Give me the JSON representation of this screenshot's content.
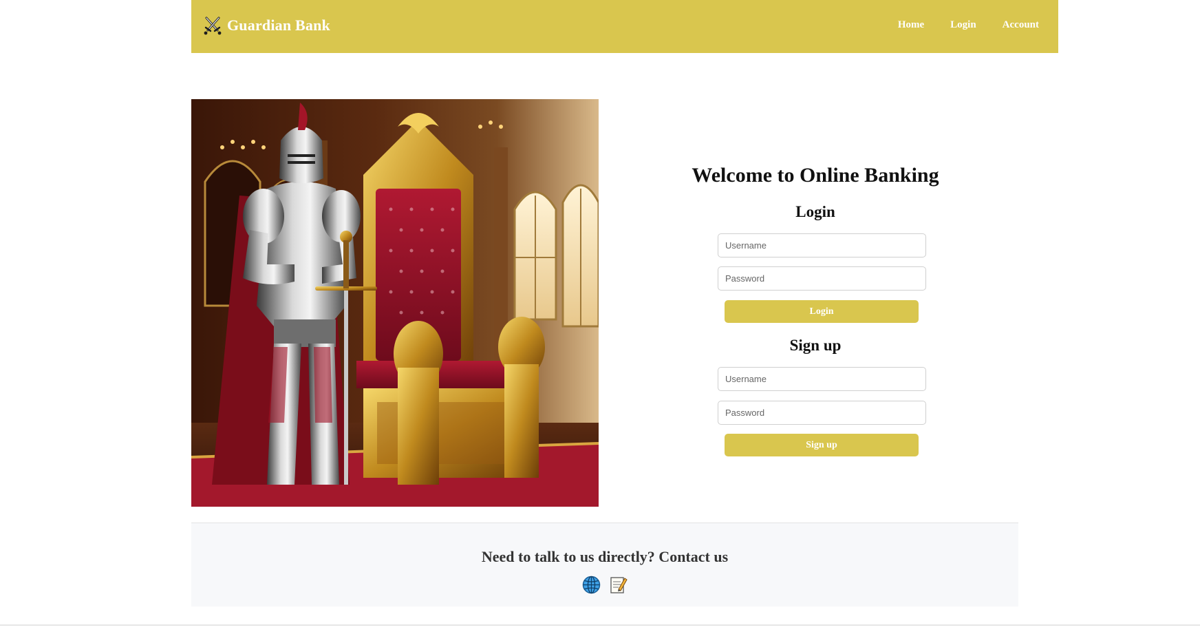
{
  "theme": {
    "brand": "#D9C64E"
  },
  "header": {
    "brand_icon": "crossed-swords-icon",
    "brand_name": "Guardian Bank",
    "nav": [
      {
        "label": "Home"
      },
      {
        "label": "Login"
      },
      {
        "label": "Account"
      }
    ]
  },
  "hero": {
    "image_subject": "knight in armor beside red-and-gold throne"
  },
  "auth": {
    "welcome": "Welcome to Online Banking",
    "login": {
      "title": "Login",
      "username_placeholder": "Username",
      "password_placeholder": "Password",
      "button_label": "Login"
    },
    "signup": {
      "title": "Sign up",
      "username_placeholder": "Username",
      "password_placeholder": "Password",
      "button_label": "Sign up"
    }
  },
  "footer": {
    "title": "Need to talk to us directly? Contact us",
    "icons": [
      "globe-icon",
      "memo-icon"
    ]
  }
}
